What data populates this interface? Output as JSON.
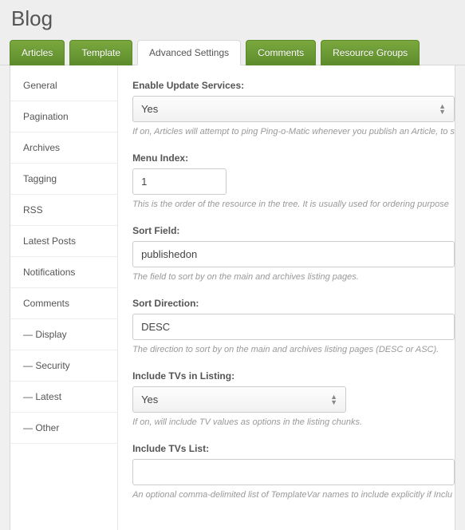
{
  "page_title": "Blog",
  "tabs": [
    {
      "label": "Articles"
    },
    {
      "label": "Template"
    },
    {
      "label": "Advanced Settings"
    },
    {
      "label": "Comments"
    },
    {
      "label": "Resource Groups"
    }
  ],
  "sidebar": {
    "items": [
      {
        "label": "General"
      },
      {
        "label": "Pagination"
      },
      {
        "label": "Archives"
      },
      {
        "label": "Tagging"
      },
      {
        "label": "RSS"
      },
      {
        "label": "Latest Posts"
      },
      {
        "label": "Notifications"
      },
      {
        "label": "Comments"
      },
      {
        "label": "— Display"
      },
      {
        "label": "— Security"
      },
      {
        "label": "— Latest"
      },
      {
        "label": "— Other"
      }
    ]
  },
  "fields": {
    "enable_update": {
      "label": "Enable Update Services:",
      "value": "Yes",
      "help": "If on, Articles will attempt to ping Ping-o-Matic whenever you publish an Article, to s"
    },
    "menu_index": {
      "label": "Menu Index:",
      "value": "1",
      "help": "This is the order of the resource in the tree. It is usually used for ordering purpose"
    },
    "sort_field": {
      "label": "Sort Field:",
      "value": "publishedon",
      "help": "The field to sort by on the main and archives listing pages."
    },
    "sort_direction": {
      "label": "Sort Direction:",
      "value": "DESC",
      "help": "The direction to sort by on the main and archives listing pages (DESC or ASC)."
    },
    "include_tvs": {
      "label": "Include TVs in Listing:",
      "value": "Yes",
      "help": "If on, will include TV values as options in the listing chunks."
    },
    "include_tvs_list": {
      "label": "Include TVs List:",
      "value": "",
      "help": "An optional comma-delimited list of TemplateVar names to include explicitly if Inclu"
    }
  }
}
